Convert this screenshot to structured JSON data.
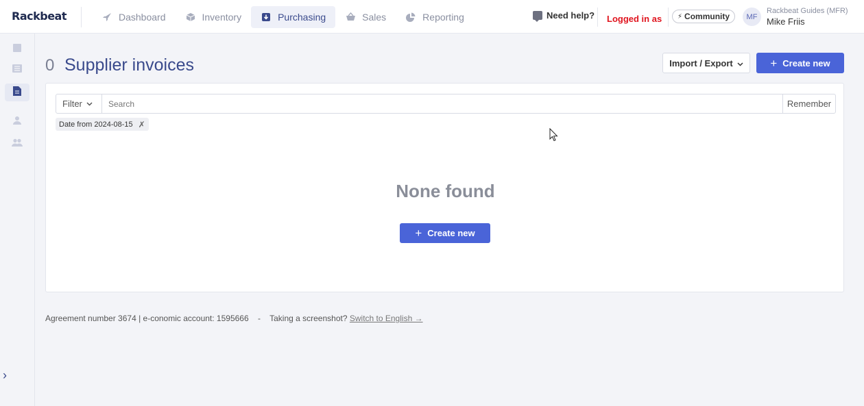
{
  "header": {
    "logo": "Rackbeat",
    "nav": [
      {
        "label": "Dashboard",
        "icon": "rocket-icon",
        "active": false
      },
      {
        "label": "Inventory",
        "icon": "box-icon",
        "active": false
      },
      {
        "label": "Purchasing",
        "icon": "download-icon",
        "active": true
      },
      {
        "label": "Sales",
        "icon": "basket-icon",
        "active": false
      },
      {
        "label": "Reporting",
        "icon": "pie-chart-icon",
        "active": false
      }
    ],
    "help_label": "Need help?",
    "logged_in_label": "Logged in as",
    "community_label": "Community",
    "avatar_initials": "MF",
    "org_name": "Rackbeat Guides (MFR)",
    "user_name": "Mike Friis"
  },
  "page": {
    "count": "0",
    "title": "Supplier invoices",
    "import_export_label": "Import / Export",
    "create_new_label": "Create new"
  },
  "filterbar": {
    "filter_label": "Filter",
    "search_placeholder": "Search",
    "remember_label": "Remember"
  },
  "active_filters": [
    {
      "label": "Date from 2024-08-15"
    }
  ],
  "empty_state": {
    "message": "None found",
    "create_label": "Create new"
  },
  "footer": {
    "agreement_text": "Agreement number 3674 | e-conomic account: 1595666",
    "separator": "-",
    "screenshot_text": "Taking a screenshot?",
    "switch_link": "Switch to English →"
  },
  "colors": {
    "brand": "#3a4a8c",
    "primary_button": "#4a64d8",
    "logged_in": "#e0141e"
  }
}
